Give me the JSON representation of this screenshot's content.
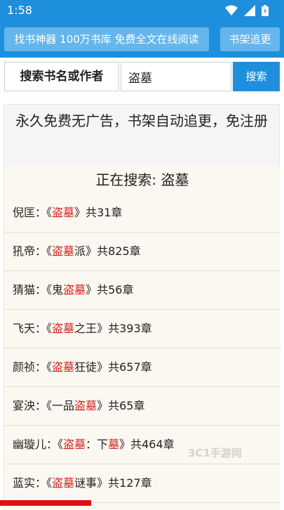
{
  "status_bar": {
    "time": "1:58"
  },
  "header": {
    "title_button": "找书神器 100万书库 免费全文在线阅读",
    "shelf_button": "书架追更"
  },
  "search": {
    "label": "搜索书名或作者",
    "value": "盗墓",
    "button": "搜索"
  },
  "notice": "永久免费无广告，书架自动追更，免注册",
  "searching_text": "正在搜索: 盗墓",
  "results": [
    {
      "author": "倪匡",
      "title_parts": [
        [
          "盗墓",
          true
        ]
      ],
      "chapters": "31"
    },
    {
      "author": "犼帝",
      "title_parts": [
        [
          "盗墓",
          true
        ],
        [
          "派",
          false
        ]
      ],
      "chapters": "825"
    },
    {
      "author": "猜猫",
      "title_parts": [
        [
          "鬼",
          false
        ],
        [
          "盗墓",
          true
        ]
      ],
      "chapters": "56"
    },
    {
      "author": "飞天",
      "title_parts": [
        [
          "盗墓",
          true
        ],
        [
          "之王",
          false
        ]
      ],
      "chapters": "393"
    },
    {
      "author": "颜祯",
      "title_parts": [
        [
          "盗墓",
          true
        ],
        [
          "狂徒",
          false
        ]
      ],
      "chapters": "657"
    },
    {
      "author": "宴泱",
      "title_parts": [
        [
          "一品",
          false
        ],
        [
          "盗墓",
          true
        ]
      ],
      "chapters": "65"
    },
    {
      "author": "幽璇儿",
      "title_parts": [
        [
          "盗墓",
          true
        ],
        [
          "：下",
          false
        ],
        [
          "墓",
          true
        ]
      ],
      "chapters": "464"
    },
    {
      "author": "蓝实",
      "title_parts": [
        [
          "盗墓",
          true
        ],
        [
          "谜事",
          false
        ]
      ],
      "chapters": "127"
    }
  ],
  "watermark": "3C1手游网",
  "colors": {
    "primary": "#1e8fdc",
    "highlight": "#d62020",
    "panel": "#fbf8f1"
  },
  "icons": [
    "wifi-icon",
    "signal-icon",
    "battery-icon"
  ]
}
